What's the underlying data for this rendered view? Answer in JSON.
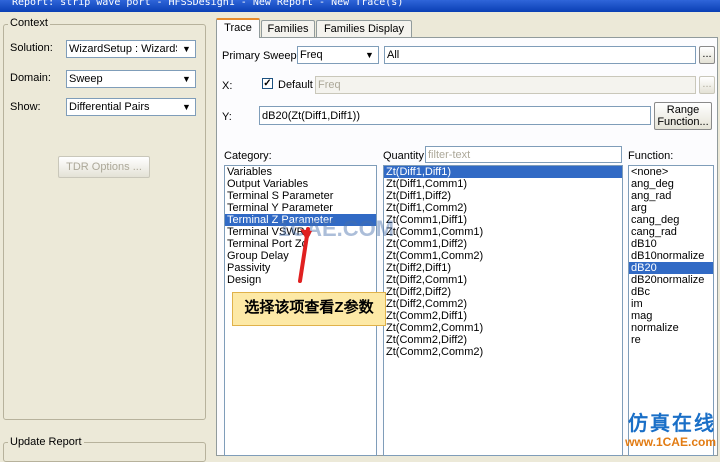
{
  "window": {
    "title": "Report: strip wave port - HFSSDesign1 - New Report - New Trace(s)"
  },
  "context": {
    "legend": "Context",
    "solution_label": "Solution:",
    "solution_value": "WizardSetup : WizardSwe",
    "domain_label": "Domain:",
    "domain_value": "Sweep",
    "show_label": "Show:",
    "show_value": "Differential Pairs",
    "tdr_button": "TDR Options ..."
  },
  "update_report": {
    "legend": "Update Report"
  },
  "tabs": [
    "Trace",
    "Families",
    "Families Display"
  ],
  "trace": {
    "primary_sweep_label": "Primary Sweep:",
    "primary_sweep_value": "Freq",
    "primary_sweep_range": "All",
    "browse_label": "...",
    "x_label": "X:",
    "default_label": "Default",
    "x_value": "Freq",
    "y_label": "Y:",
    "y_value": "dB20(Zt(Diff1,Diff1))",
    "range_button_line1": "Range",
    "range_button_line2": "Function..."
  },
  "category": {
    "label": "Category:",
    "items": [
      "Variables",
      "Output Variables",
      "Terminal S Parameter",
      "Terminal Y Parameter",
      "Terminal Z Parameter",
      "Terminal VSWR",
      "Terminal Port Zo",
      "Group Delay",
      "Passivity",
      "Design"
    ],
    "selected_index": 4
  },
  "quantity": {
    "label": "Quantity:",
    "filter_placeholder": "filter-text",
    "items": [
      "Zt(Diff1,Diff1)",
      "Zt(Diff1,Comm1)",
      "Zt(Diff1,Diff2)",
      "Zt(Diff1,Comm2)",
      "Zt(Comm1,Diff1)",
      "Zt(Comm1,Comm1)",
      "Zt(Comm1,Diff2)",
      "Zt(Comm1,Comm2)",
      "Zt(Diff2,Diff1)",
      "Zt(Diff2,Comm1)",
      "Zt(Diff2,Diff2)",
      "Zt(Diff2,Comm2)",
      "Zt(Comm2,Diff1)",
      "Zt(Comm2,Comm1)",
      "Zt(Comm2,Diff2)",
      "Zt(Comm2,Comm2)"
    ],
    "selected_index": 0
  },
  "function": {
    "label": "Function:",
    "items": [
      "<none>",
      "ang_deg",
      "ang_rad",
      "arg",
      "cang_deg",
      "cang_rad",
      "dB10",
      "dB10normalize",
      "dB20",
      "dB20normalize",
      "dBc",
      "im",
      "mag",
      "normalize",
      "re"
    ],
    "selected_index": 8
  },
  "annotation": {
    "callout_text": "选择该项查看Z参数",
    "arrow_color": "#e02020"
  },
  "watermark": {
    "center_text": "1CAE.COM",
    "cn_text": "仿真在线",
    "url_text": "www.1CAE.com"
  },
  "colors": {
    "selection": "#316ac5",
    "tab_accent": "#e68b2c"
  }
}
